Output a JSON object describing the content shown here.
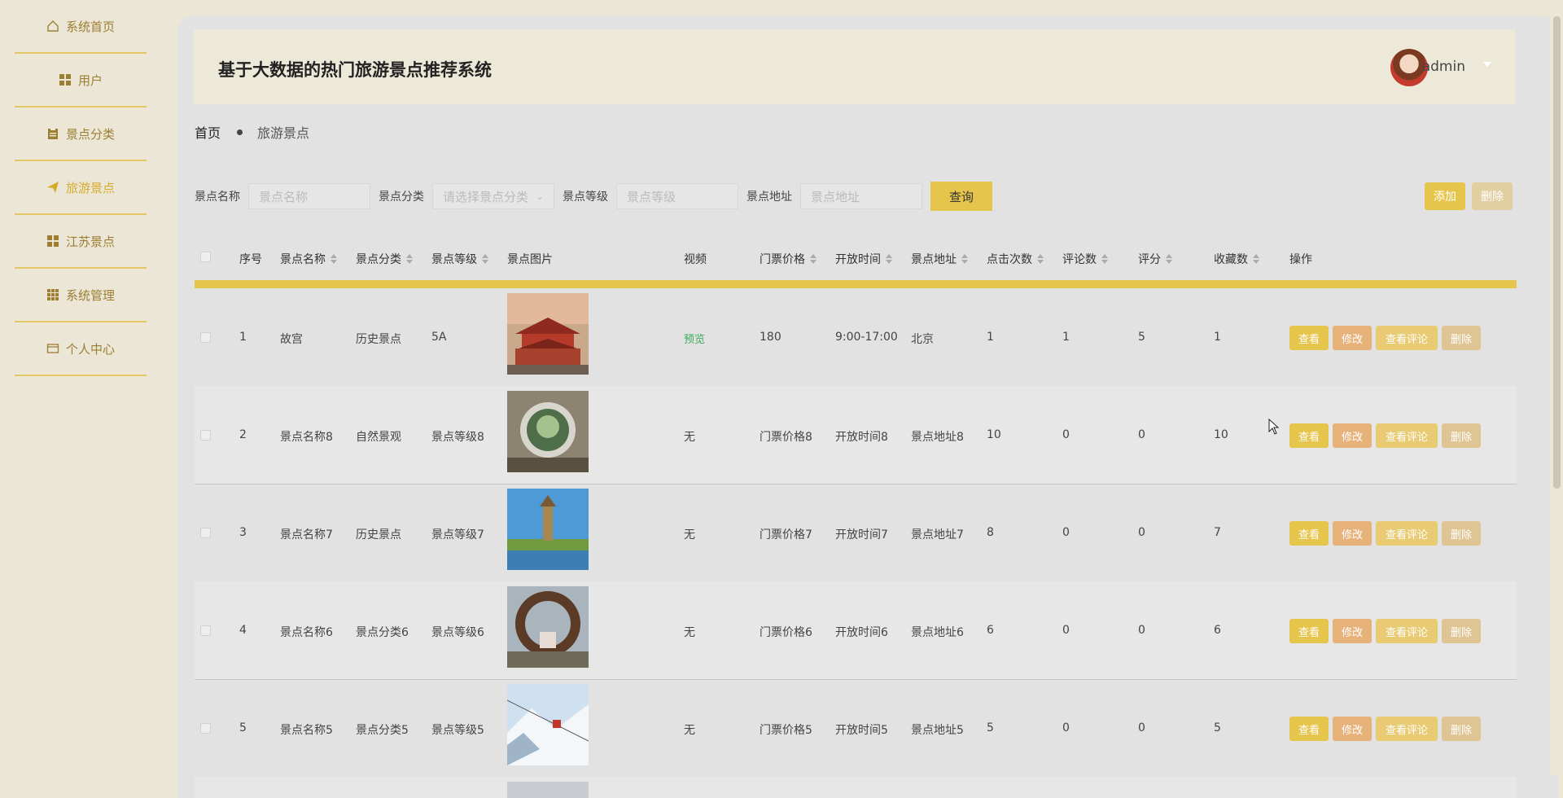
{
  "sidebar": {
    "items": [
      {
        "label": "系统首页",
        "icon": "home-icon"
      },
      {
        "label": "用户",
        "icon": "grid-icon"
      },
      {
        "label": "景点分类",
        "icon": "clipboard-icon"
      },
      {
        "label": "旅游景点",
        "icon": "send-icon",
        "active": true
      },
      {
        "label": "江苏景点",
        "icon": "grid-icon"
      },
      {
        "label": "系统管理",
        "icon": "apps-icon"
      },
      {
        "label": "个人中心",
        "icon": "card-icon"
      }
    ]
  },
  "header": {
    "title": "基于大数据的热门旅游景点推荐系统",
    "username": "admin"
  },
  "breadcrumb": {
    "home": "首页",
    "current": "旅游景点"
  },
  "search": {
    "name_label": "景点名称",
    "name_placeholder": "景点名称",
    "category_label": "景点分类",
    "category_placeholder": "请选择景点分类",
    "level_label": "景点等级",
    "level_placeholder": "景点等级",
    "address_label": "景点地址",
    "address_placeholder": "景点地址",
    "query_label": "查询",
    "add_label": "添加",
    "delete_label": "删除"
  },
  "table": {
    "headers": {
      "index": "序号",
      "name": "景点名称",
      "category": "景点分类",
      "level": "景点等级",
      "image": "景点图片",
      "video": "视频",
      "price": "门票价格",
      "hours": "开放时间",
      "address": "景点地址",
      "clicks": "点击次数",
      "comments": "评论数",
      "rating": "评分",
      "favorites": "收藏数",
      "actions": "操作"
    },
    "actions": {
      "view": "查看",
      "edit": "修改",
      "comments": "查看评论",
      "delete": "删除"
    },
    "rows": [
      {
        "index": "1",
        "name": "故宫",
        "category": "历史景点",
        "level": "5A",
        "video": "预览",
        "price": "180",
        "hours": "9:00-17:00",
        "address": "北京",
        "clicks": "1",
        "comments": "1",
        "rating": "5",
        "favorites": "1"
      },
      {
        "index": "2",
        "name": "景点名称8",
        "category": "自然景观",
        "level": "景点等级8",
        "video": "无",
        "price": "门票价格8",
        "hours": "开放时间8",
        "address": "景点地址8",
        "clicks": "10",
        "comments": "0",
        "rating": "0",
        "favorites": "10"
      },
      {
        "index": "3",
        "name": "景点名称7",
        "category": "历史景点",
        "level": "景点等级7",
        "video": "无",
        "price": "门票价格7",
        "hours": "开放时间7",
        "address": "景点地址7",
        "clicks": "8",
        "comments": "0",
        "rating": "0",
        "favorites": "7"
      },
      {
        "index": "4",
        "name": "景点名称6",
        "category": "景点分类6",
        "level": "景点等级6",
        "video": "无",
        "price": "门票价格6",
        "hours": "开放时间6",
        "address": "景点地址6",
        "clicks": "6",
        "comments": "0",
        "rating": "0",
        "favorites": "6"
      },
      {
        "index": "5",
        "name": "景点名称5",
        "category": "景点分类5",
        "level": "景点等级5",
        "video": "无",
        "price": "门票价格5",
        "hours": "开放时间5",
        "address": "景点地址5",
        "clicks": "5",
        "comments": "0",
        "rating": "0",
        "favorites": "5"
      }
    ]
  },
  "colors": {
    "accent": "#e6c54c",
    "sidebar_text": "#9c7f33",
    "preview_link": "#3aaa5c"
  }
}
